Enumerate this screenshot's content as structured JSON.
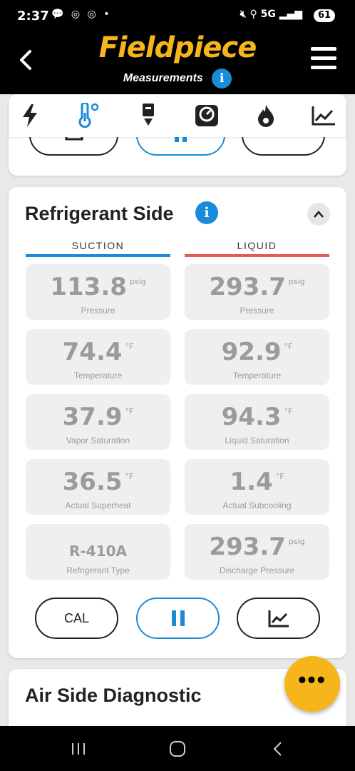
{
  "status_bar": {
    "time": "2:37",
    "left_icons": "💬 ◎ ◎ •",
    "network": "5G",
    "battery": "61"
  },
  "header": {
    "brand": "Fieldpiece",
    "subtitle": "Measurements",
    "info_label": "i"
  },
  "tool_tabs": [
    "power-icon",
    "thermometer-icon",
    "pressure-probe-icon",
    "gauge-icon",
    "flame-icon",
    "trend-chart-icon"
  ],
  "accent_colors": {
    "brand": "#f7b51c",
    "blue": "#1a8bd8",
    "suction": "#1a8bd8",
    "liquid": "#e05a5a"
  },
  "refrigerant_side": {
    "title": "Refrigerant Side",
    "info_label": "i",
    "suction_label": "SUCTION",
    "liquid_label": "LIQUID",
    "suction": [
      {
        "value": "113.8",
        "unit": "psig",
        "label": "Pressure"
      },
      {
        "value": "74.4",
        "unit": "°F",
        "label": "Temperature"
      },
      {
        "value": "37.9",
        "unit": "°F",
        "label": "Vapor Saturation"
      },
      {
        "value": "36.5",
        "unit": "°F",
        "label": "Actual Superheat"
      },
      {
        "value": "R-410A",
        "unit": "",
        "label": "Refrigerant Type"
      }
    ],
    "liquid": [
      {
        "value": "293.7",
        "unit": "psig",
        "label": "Pressure"
      },
      {
        "value": "92.9",
        "unit": "°F",
        "label": "Temperature"
      },
      {
        "value": "94.3",
        "unit": "°F",
        "label": "Liquid Saturation"
      },
      {
        "value": "1.4",
        "unit": "°F",
        "label": "Actual Subcooling"
      },
      {
        "value": "293.7",
        "unit": "psig",
        "label": "Discharge Pressure"
      }
    ],
    "cal_label": "CAL"
  },
  "air_side": {
    "title": "Air Side Diagnostic"
  }
}
